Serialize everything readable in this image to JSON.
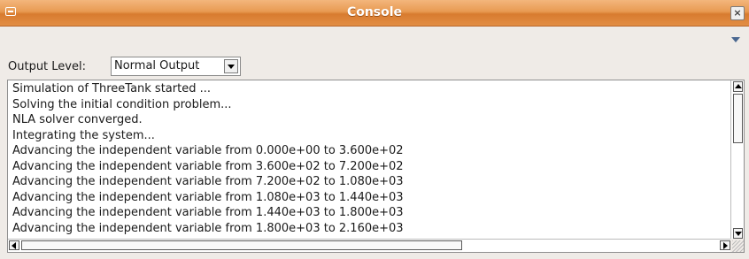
{
  "window": {
    "title": "Console",
    "icon": "console-window-icon",
    "close_label": "×",
    "accent_color": "#e28e45"
  },
  "toolbar": {
    "menu_icon": "view-menu-arrow-icon",
    "output_level_label": "Output Level:",
    "output_level_value": "Normal Output"
  },
  "console": {
    "lines": [
      "Simulation of ThreeTank started ...",
      "Solving the initial condition problem...",
      "NLA solver converged.",
      "Integrating the system...",
      "Advancing the independent variable from 0.000e+00 to 3.600e+02",
      "Advancing the independent variable from 3.600e+02 to 7.200e+02",
      "Advancing the independent variable from 7.200e+02 to 1.080e+03",
      "Advancing the independent variable from 1.080e+03 to 1.440e+03",
      "Advancing the independent variable from 1.440e+03 to 1.800e+03",
      "Advancing the independent variable from 1.800e+03 to 2.160e+03"
    ]
  }
}
